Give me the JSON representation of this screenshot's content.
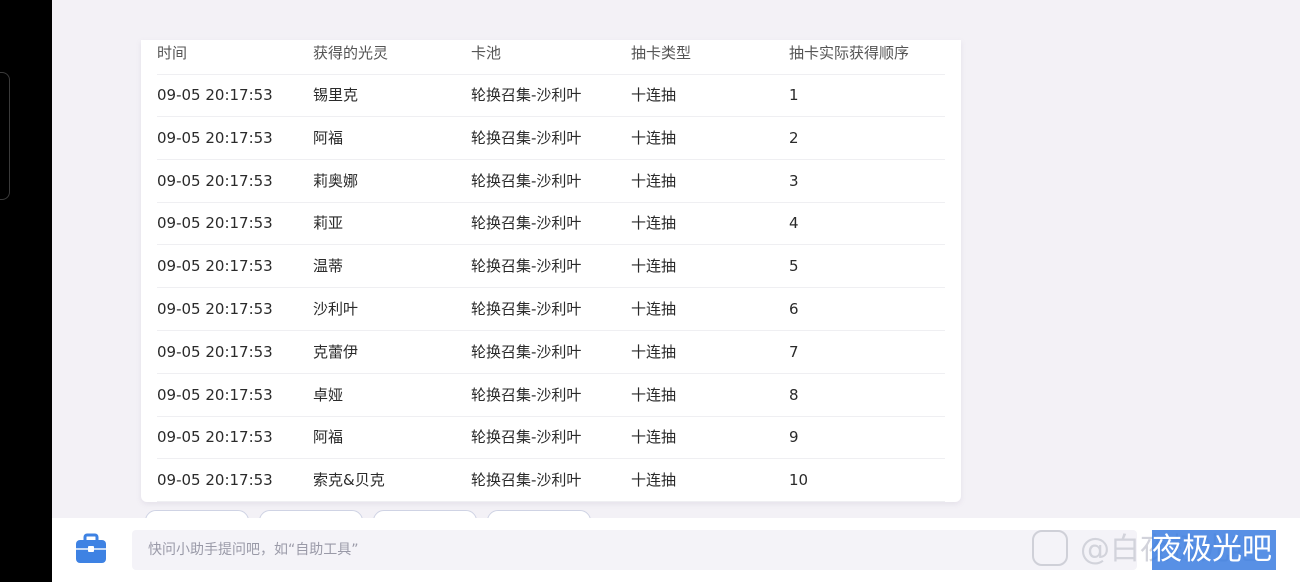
{
  "table": {
    "headers": [
      "时间",
      "获得的光灵",
      "卡池",
      "抽卡类型",
      "抽卡实际获得顺序"
    ],
    "rows": [
      [
        "09-05 20:17:53",
        "锡里克",
        "轮换召集-沙利叶",
        "十连抽",
        "1"
      ],
      [
        "09-05 20:17:53",
        "阿福",
        "轮换召集-沙利叶",
        "十连抽",
        "2"
      ],
      [
        "09-05 20:17:53",
        "莉奥娜",
        "轮换召集-沙利叶",
        "十连抽",
        "3"
      ],
      [
        "09-05 20:17:53",
        "莉亚",
        "轮换召集-沙利叶",
        "十连抽",
        "4"
      ],
      [
        "09-05 20:17:53",
        "温蒂",
        "轮换召集-沙利叶",
        "十连抽",
        "5"
      ],
      [
        "09-05 20:17:53",
        "沙利叶",
        "轮换召集-沙利叶",
        "十连抽",
        "6"
      ],
      [
        "09-05 20:17:53",
        "克蕾伊",
        "轮换召集-沙利叶",
        "十连抽",
        "7"
      ],
      [
        "09-05 20:17:53",
        "卓娅",
        "轮换召集-沙利叶",
        "十连抽",
        "8"
      ],
      [
        "09-05 20:17:53",
        "阿福",
        "轮换召集-沙利叶",
        "十连抽",
        "9"
      ],
      [
        "09-05 20:17:53",
        "索克&贝克",
        "轮换召集-沙利叶",
        "十连抽",
        "10"
      ]
    ]
  },
  "assistant": {
    "placeholder": "快问小助手提问吧，如“自助工具”",
    "tool_icon": "toolbox-icon"
  },
  "watermark": {
    "text": "@白夜极光吧",
    "highlight": "夜极光吧",
    "icon": "tieba-bear-icon"
  },
  "colors": {
    "accent": "#3b7de0",
    "icon_blue": "#3e82e3",
    "background": "#f3f1f6"
  }
}
